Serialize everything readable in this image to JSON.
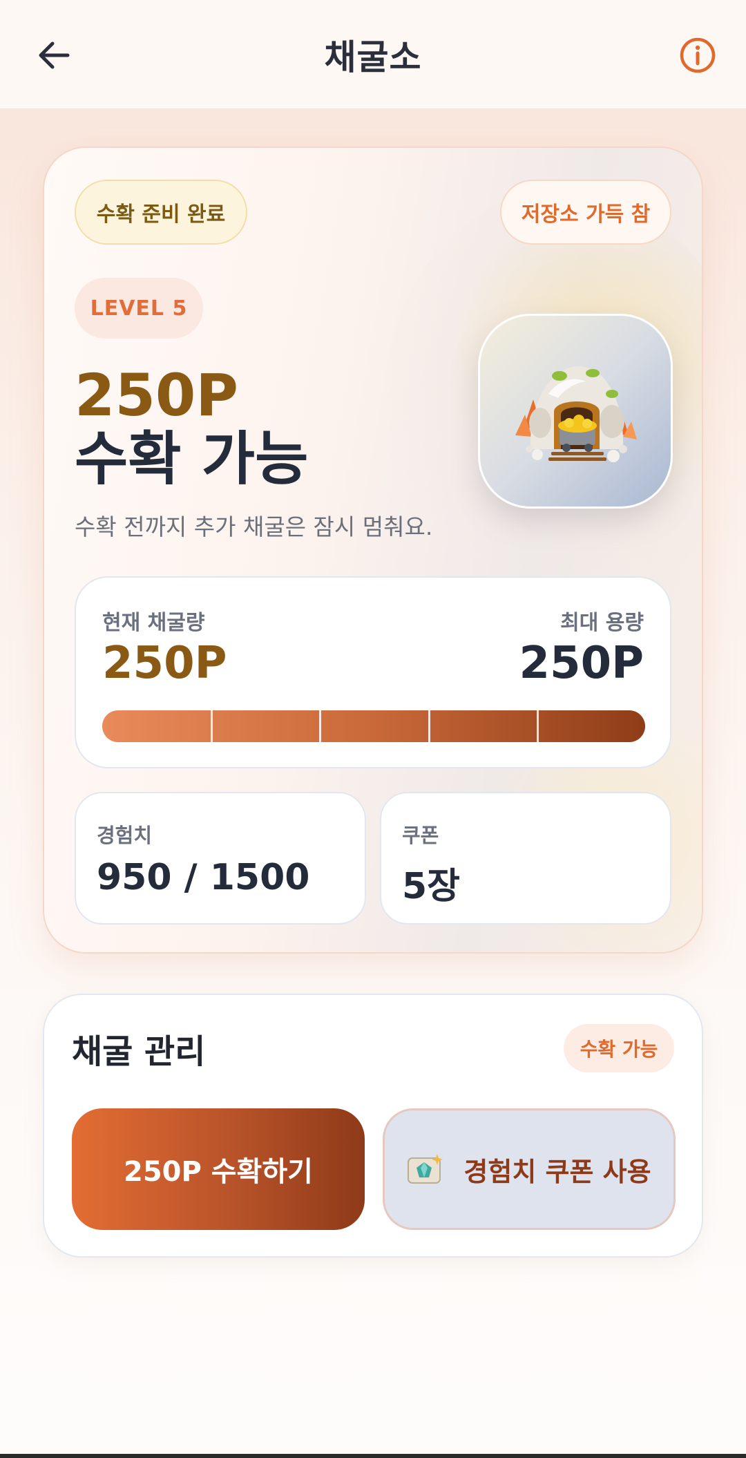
{
  "header": {
    "title": "채굴소",
    "back_icon": "arrow-left-icon",
    "info_icon": "info-circle-icon"
  },
  "hero": {
    "status_ready": "수확 준비 완료",
    "status_full": "저장소 가득 참",
    "level": "LEVEL 5",
    "points": "250P",
    "title": "수확 가능",
    "subtitle": "수확 전까지 추가 채굴은 잠시 멈춰요.",
    "image": "mine-cart-icon"
  },
  "capacity": {
    "current_label": "현재 채굴량",
    "current_value": "250P",
    "max_label": "최대 용량",
    "max_value": "250P",
    "fill_percent": 100,
    "segments": 5
  },
  "stats": {
    "exp_label": "경험치",
    "exp_value": "950 / 1500",
    "coupon_label": "쿠폰",
    "coupon_value": "5장"
  },
  "manage": {
    "title": "채굴 관리",
    "badge": "수확 가능",
    "harvest_button": "250P 수확하기",
    "coupon_button": "경험치 쿠폰 사용",
    "coupon_icon": "gem-ticket-icon"
  },
  "colors": {
    "accent": "#e06a2c",
    "gold": "#8a5a14",
    "dark": "#242b3a"
  }
}
